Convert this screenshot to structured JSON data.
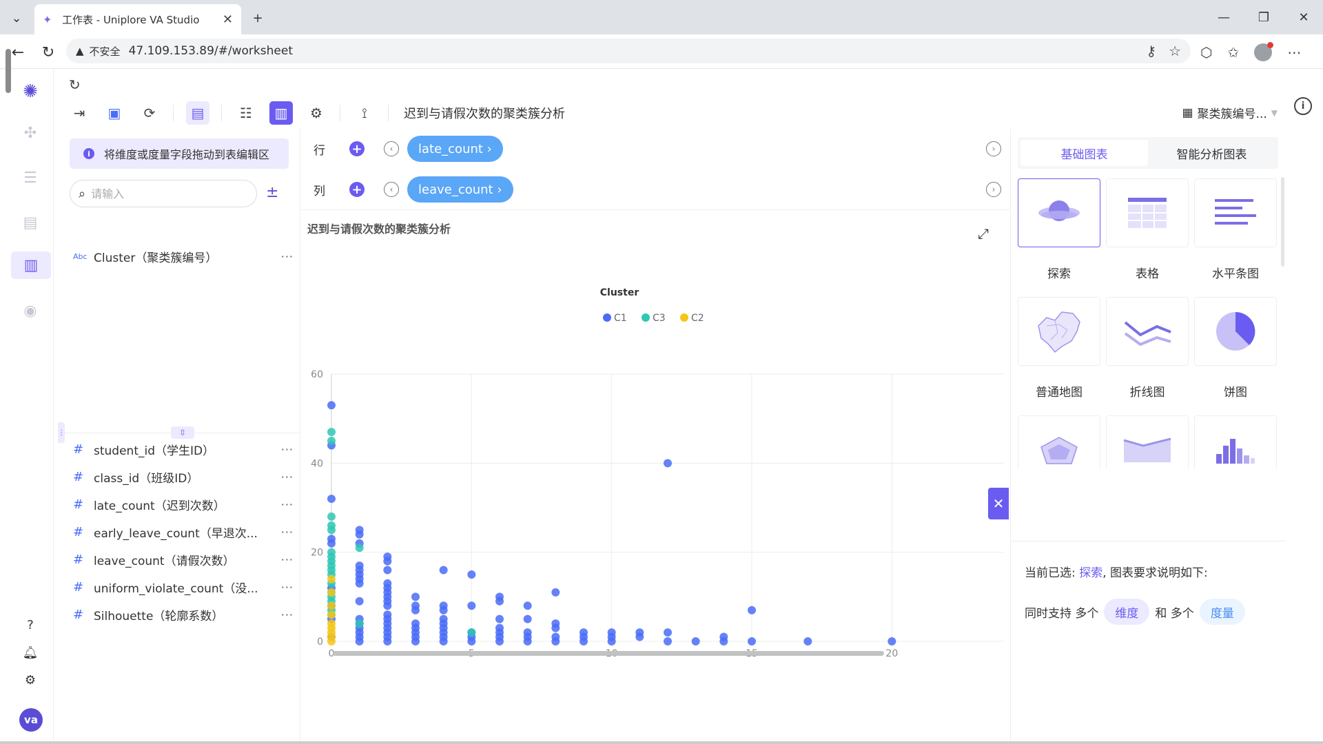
{
  "browser": {
    "tab_title": "工作表 - Uniplore VA Studio",
    "address_insecure": "不安全",
    "address_url": "47.109.153.89/#/worksheet"
  },
  "toolbar": {
    "sheet_title": "迟到与请假次数的聚类簇分析",
    "cluster_select": "聚类簇编号..."
  },
  "field_panel": {
    "hint": "将维度或度量字段拖动到表编辑区",
    "search_placeholder": "请输入",
    "dimensions": [
      {
        "type": "Abc",
        "name": "Cluster（聚类簇编号）"
      }
    ],
    "measures": [
      {
        "type": "#",
        "name": "student_id（学生ID）"
      },
      {
        "type": "#",
        "name": "class_id（班级ID）"
      },
      {
        "type": "#",
        "name": "late_count（迟到次数）"
      },
      {
        "type": "#",
        "name": "early_leave_count（早退次..."
      },
      {
        "type": "#",
        "name": "leave_count（请假次数）"
      },
      {
        "type": "#",
        "name": "uniform_violate_count（没..."
      },
      {
        "type": "#",
        "name": "Silhouette（轮廓系数）"
      }
    ],
    "more": "···"
  },
  "shelves": {
    "row_label": "行",
    "row_pill": "late_count ›",
    "col_label": "列",
    "col_pill": "leave_count ›"
  },
  "chart_data": {
    "type": "scatter",
    "title": "迟到与请假次数的聚类簇分析",
    "legend_title": "Cluster",
    "legend_position": "top-center",
    "grid": true,
    "xlim": [
      0,
      24
    ],
    "ylim": [
      0,
      60
    ],
    "x_ticks": [
      0,
      5,
      10,
      15,
      20
    ],
    "y_ticks": [
      0,
      20,
      40,
      60
    ],
    "series": [
      {
        "name": "C1",
        "color": "#4a6cf7",
        "points": [
          [
            0,
            53
          ],
          [
            0,
            44
          ],
          [
            0,
            32
          ],
          [
            0,
            23
          ],
          [
            0,
            22
          ],
          [
            0,
            12
          ],
          [
            0,
            8
          ],
          [
            0,
            5
          ],
          [
            0,
            1
          ],
          [
            1,
            25
          ],
          [
            1,
            24
          ],
          [
            1,
            22
          ],
          [
            1,
            17
          ],
          [
            1,
            16
          ],
          [
            1,
            15
          ],
          [
            1,
            14
          ],
          [
            1,
            13
          ],
          [
            1,
            9
          ],
          [
            1,
            5
          ],
          [
            1,
            4
          ],
          [
            1,
            3
          ],
          [
            1,
            2
          ],
          [
            1,
            1
          ],
          [
            1,
            0
          ],
          [
            2,
            19
          ],
          [
            2,
            18
          ],
          [
            2,
            16
          ],
          [
            2,
            13
          ],
          [
            2,
            12
          ],
          [
            2,
            11
          ],
          [
            2,
            10
          ],
          [
            2,
            9
          ],
          [
            2,
            8
          ],
          [
            2,
            6
          ],
          [
            2,
            5
          ],
          [
            2,
            4
          ],
          [
            2,
            3
          ],
          [
            2,
            2
          ],
          [
            2,
            1
          ],
          [
            2,
            0
          ],
          [
            3,
            10
          ],
          [
            3,
            8
          ],
          [
            3,
            7
          ],
          [
            3,
            4
          ],
          [
            3,
            3
          ],
          [
            3,
            2
          ],
          [
            3,
            1
          ],
          [
            3,
            0
          ],
          [
            4,
            16
          ],
          [
            4,
            8
          ],
          [
            4,
            7
          ],
          [
            4,
            5
          ],
          [
            4,
            4
          ],
          [
            4,
            3
          ],
          [
            4,
            2
          ],
          [
            4,
            1
          ],
          [
            4,
            0
          ],
          [
            5,
            15
          ],
          [
            5,
            8
          ],
          [
            5,
            2
          ],
          [
            5,
            1
          ],
          [
            5,
            0
          ],
          [
            6,
            10
          ],
          [
            6,
            9
          ],
          [
            6,
            5
          ],
          [
            6,
            3
          ],
          [
            6,
            2
          ],
          [
            6,
            1
          ],
          [
            6,
            0
          ],
          [
            7,
            8
          ],
          [
            7,
            5
          ],
          [
            7,
            2
          ],
          [
            7,
            1
          ],
          [
            7,
            0
          ],
          [
            8,
            11
          ],
          [
            8,
            4
          ],
          [
            8,
            3
          ],
          [
            8,
            1
          ],
          [
            8,
            0
          ],
          [
            9,
            2
          ],
          [
            9,
            1
          ],
          [
            9,
            0
          ],
          [
            10,
            2
          ],
          [
            10,
            1
          ],
          [
            10,
            0
          ],
          [
            11,
            2
          ],
          [
            11,
            1
          ],
          [
            12,
            40
          ],
          [
            12,
            2
          ],
          [
            12,
            0
          ],
          [
            13,
            0
          ],
          [
            14,
            1
          ],
          [
            14,
            0
          ],
          [
            15,
            7
          ],
          [
            15,
            0
          ],
          [
            17,
            0
          ],
          [
            20,
            0
          ]
        ]
      },
      {
        "name": "C3",
        "color": "#2ec7b4",
        "points": [
          [
            0,
            47
          ],
          [
            0,
            45
          ],
          [
            0,
            28
          ],
          [
            0,
            26
          ],
          [
            0,
            25
          ],
          [
            0,
            20
          ],
          [
            0,
            19
          ],
          [
            0,
            18
          ],
          [
            0,
            17
          ],
          [
            0,
            16
          ],
          [
            0,
            15
          ],
          [
            0,
            13
          ],
          [
            0,
            11
          ],
          [
            0,
            10
          ],
          [
            0,
            9
          ],
          [
            0,
            7
          ],
          [
            0,
            6
          ],
          [
            1,
            21
          ],
          [
            1,
            4
          ],
          [
            5,
            2
          ]
        ]
      },
      {
        "name": "C2",
        "color": "#f5c518",
        "points": [
          [
            0,
            14
          ],
          [
            0,
            11
          ],
          [
            0,
            8
          ],
          [
            0,
            6
          ],
          [
            0,
            4
          ],
          [
            0,
            3
          ],
          [
            0,
            2
          ],
          [
            0,
            1
          ],
          [
            0,
            0
          ]
        ]
      }
    ]
  },
  "right_panel": {
    "tabs": [
      "基础图表",
      "智能分析图表"
    ],
    "charts": [
      "探索",
      "表格",
      "水平条图",
      "普通地图",
      "折线图",
      "饼图"
    ],
    "desc_prefix": "当前已选: ",
    "desc_selected": "探索",
    "desc_suffix": ", 图表要求说明如下:",
    "support_prefix": "同时支持 多个",
    "tag_dimension": "维度",
    "support_mid": "和 多个",
    "tag_measure": "度量"
  },
  "rail": {
    "avatar": "va"
  }
}
